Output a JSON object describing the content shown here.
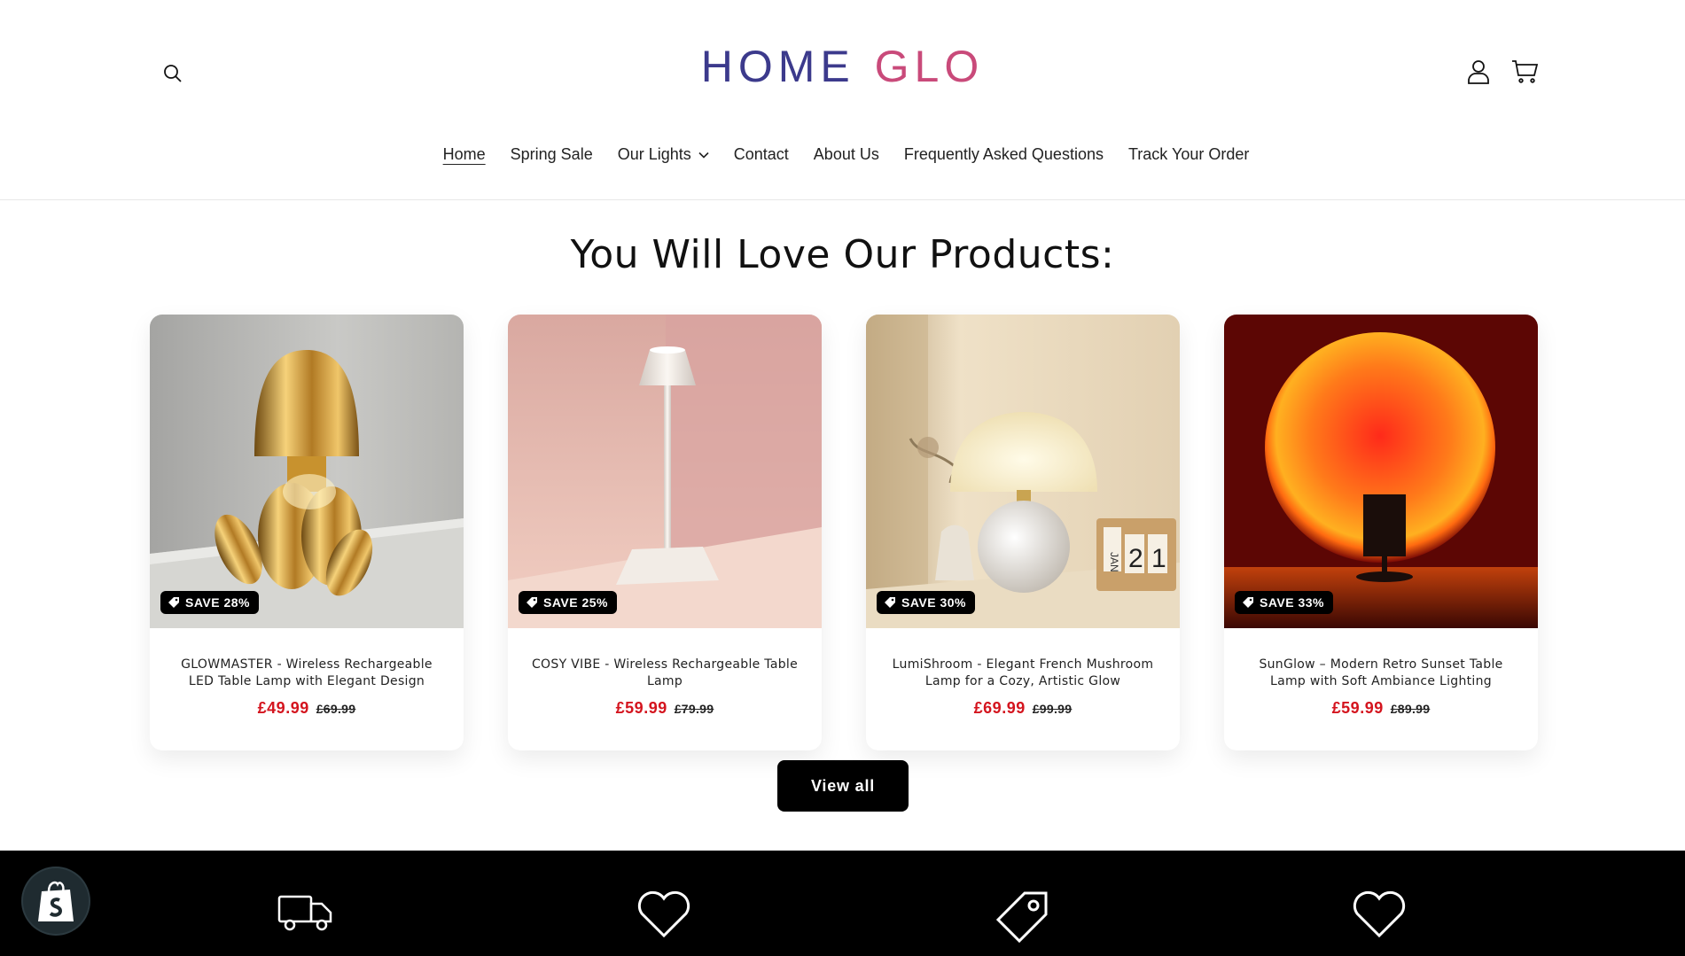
{
  "brand": {
    "part1": "HOME",
    "part2": "GLO"
  },
  "nav": {
    "items": [
      {
        "label": "Home"
      },
      {
        "label": "Spring Sale"
      },
      {
        "label": "Our Lights"
      },
      {
        "label": "Contact"
      },
      {
        "label": "About Us"
      },
      {
        "label": "Frequently Asked Questions"
      },
      {
        "label": "Track Your Order"
      }
    ]
  },
  "section": {
    "title": "You Will Love Our Products:"
  },
  "products": [
    {
      "badge": "SAVE 28%",
      "name": "GLOWMASTER - Wireless Rechargeable LED Table Lamp with Elegant Design",
      "price": "£49.99",
      "old_price": "£69.99"
    },
    {
      "badge": "SAVE 25%",
      "name": "COSY VIBE - Wireless Rechargeable Table Lamp",
      "price": "£59.99",
      "old_price": "£79.99"
    },
    {
      "badge": "SAVE 30%",
      "name": "LumiShroom - Elegant French Mushroom Lamp for a Cozy, Artistic Glow",
      "price": "£69.99",
      "old_price": "£99.99"
    },
    {
      "badge": "SAVE 33%",
      "name": "SunGlow – Modern Retro Sunset Table Lamp with Soft Ambiance Lighting",
      "price": "£59.99",
      "old_price": "£89.99"
    }
  ],
  "view_all": "View all",
  "calendar": {
    "month": "JAN",
    "d1": "2",
    "d2": "1"
  },
  "colors": {
    "brand_primary": "#3c3a8c",
    "brand_accent": "#c94a7a",
    "sale_price": "#d4141e"
  },
  "icons": [
    "search-icon",
    "account-icon",
    "cart-icon",
    "chevron-down-icon",
    "tag-icon",
    "truck-icon",
    "heart-icon",
    "price-tag-icon",
    "shopify-bag-icon"
  ]
}
